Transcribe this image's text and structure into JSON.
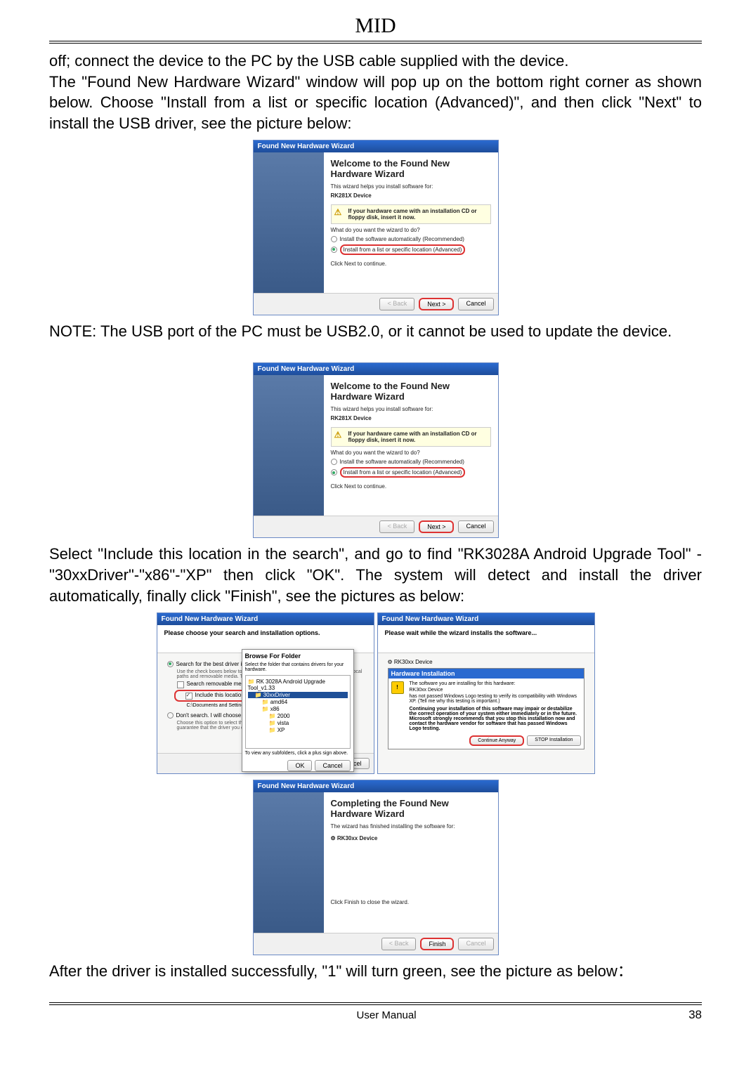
{
  "header": {
    "title": "MID"
  },
  "para1": "off; connect the device to the PC by the USB cable supplied with the device.",
  "para2": "The \"Found New Hardware Wizard\" window will pop up on the bottom right corner as shown below. Choose \"Install from a list or specific location (Advanced)\", and then click \"Next\" to install the USB driver, see the picture below:",
  "note1": "NOTE: The USB port of the PC must be USB2.0, or it cannot be used to update the device.",
  "para3": "Select \"Include this location in the search\", and go to find \"RK3028A Android Upgrade Tool\" -\"30xxDriver\"-\"x86\"-\"XP\" then click \"OK\". The system will detect and install the driver automatically, finally click \"Finish\", see the pictures as below:",
  "para4": "After the driver is installed successfully, \"1\" will turn green, see the picture as below：",
  "wizard": {
    "titlebar": "Found New Hardware Wizard",
    "heading": "Welcome to the Found New Hardware Wizard",
    "subtext": "This wizard helps you install software for:",
    "device": "RK281X Device",
    "infobox": "If your hardware came with an installation CD or floppy disk, insert it now.",
    "question": "What do you want the wizard to do?",
    "radio_auto": "Install the software automatically (Recommended)",
    "radio_list": "Install from a list or specific location (Advanced)",
    "click_next": "Click Next to continue.",
    "back": "< Back",
    "next": "Next >",
    "cancel": "Cancel"
  },
  "browse_wizard": {
    "header": "Please choose your search and installation options.",
    "opt1": "Search for the best driver in these locations.",
    "opt1_sub": "Use the check boxes below to limit or expand the default search, which includes local paths and removable media. The best driver found will be installed.",
    "chk1": "Search removable media (floppy, CD-ROM...)",
    "chk2": "Include this location in the search:",
    "path": "C:\\Documents and Settings\\...",
    "opt2": "Don't search. I will choose the driver to install.",
    "opt2_sub": "Choose this option to select the device driver from a list. Windows does not guarantee that the driver you choose will be the best match for your hardware.",
    "browse_title": "Browse For Folder",
    "browse_sub": "Select the folder that contains drivers for your hardware.",
    "tree_root": "RK 3028A Android Upgrade Tool_v1.33",
    "tree_30xx": "30xxDriver",
    "tree_amd64": "amd64",
    "tree_x86": "x86",
    "tree_2000": "2000",
    "tree_vista": "vista",
    "tree_xp": "XP",
    "to_view": "To view any subfolders, click a plus sign above.",
    "ok": "OK",
    "cancel": "Cancel"
  },
  "install_wizard": {
    "header": "Please wait while the wizard installs the software...",
    "hw_install": "Hardware Installation",
    "device_line": "RK30xx Device",
    "warn1": "The software you are installing for this hardware:",
    "warn2": "RK30xx Device",
    "warn3": "has not passed Windows Logo testing to verify its compatibility with Windows XP. (Tell me why this testing is important.)",
    "warn4": "Continuing your installation of this software may impair or destabilize the correct operation of your system either immediately or in the future. Microsoft strongly recommends that you stop this installation now and contact the hardware vendor for software that has passed Windows Logo testing.",
    "continue": "Continue Anyway",
    "stop": "STOP Installation"
  },
  "complete_wizard": {
    "heading": "Completing the Found New Hardware Wizard",
    "text": "The wizard has finished installing the software for:",
    "device": "RK30xx Device",
    "finish_text": "Click Finish to close the wizard.",
    "finish": "Finish"
  },
  "footer": {
    "label": "User Manual",
    "page": "38"
  }
}
